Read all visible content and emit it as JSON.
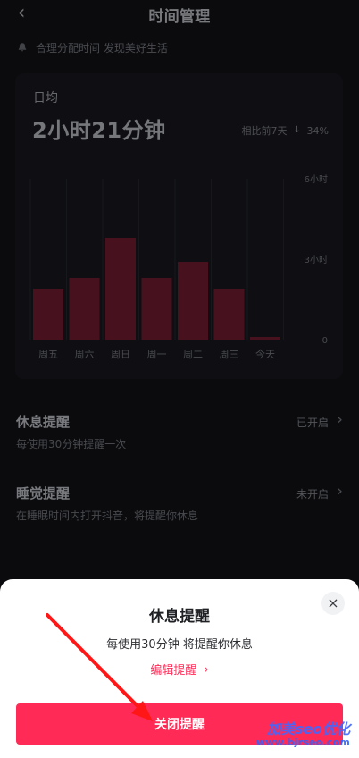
{
  "header": {
    "title": "时间管理",
    "back_icon": "‹"
  },
  "tip": {
    "text": "合理分配时间 发现美好生活",
    "icon": "bell-icon"
  },
  "stats": {
    "avg_label": "日均",
    "avg_value": "2小时21分钟",
    "compare_label": "相比前7天",
    "compare_change": "34%",
    "compare_direction": "down"
  },
  "chart_data": {
    "type": "bar",
    "categories": [
      "周五",
      "周六",
      "周日",
      "周一",
      "周二",
      "周三",
      "今天"
    ],
    "values": [
      1.9,
      2.3,
      3.8,
      2.3,
      2.9,
      1.9,
      0.1
    ],
    "ylim": [
      0,
      6
    ],
    "y_tick_labels": [
      "6小时",
      "3小时",
      "0"
    ],
    "grid": "vertical-right-axis-labels",
    "bar_color": "#6d1b2e"
  },
  "settings": {
    "rest": {
      "title": "休息提醒",
      "desc": "每使用30分钟提醒一次",
      "status": "已开启",
      "chevron": "›"
    },
    "sleep": {
      "title": "睡觉提醒",
      "desc": "在睡眠时间内打开抖音，将提醒你休息",
      "status": "未开启",
      "chevron": "›"
    }
  },
  "sheet": {
    "title": "休息提醒",
    "desc": "每使用30分钟 将提醒你休息",
    "edit_label": "编辑提醒",
    "edit_chevron": "›",
    "close_label": "×",
    "primary_button": "关闭提醒"
  },
  "watermark": {
    "line1": "加美seo优化",
    "line2": "www.bjrseo.com"
  },
  "colors": {
    "accent": "#ff2b56",
    "background": "#111216",
    "card": "#17181d"
  }
}
